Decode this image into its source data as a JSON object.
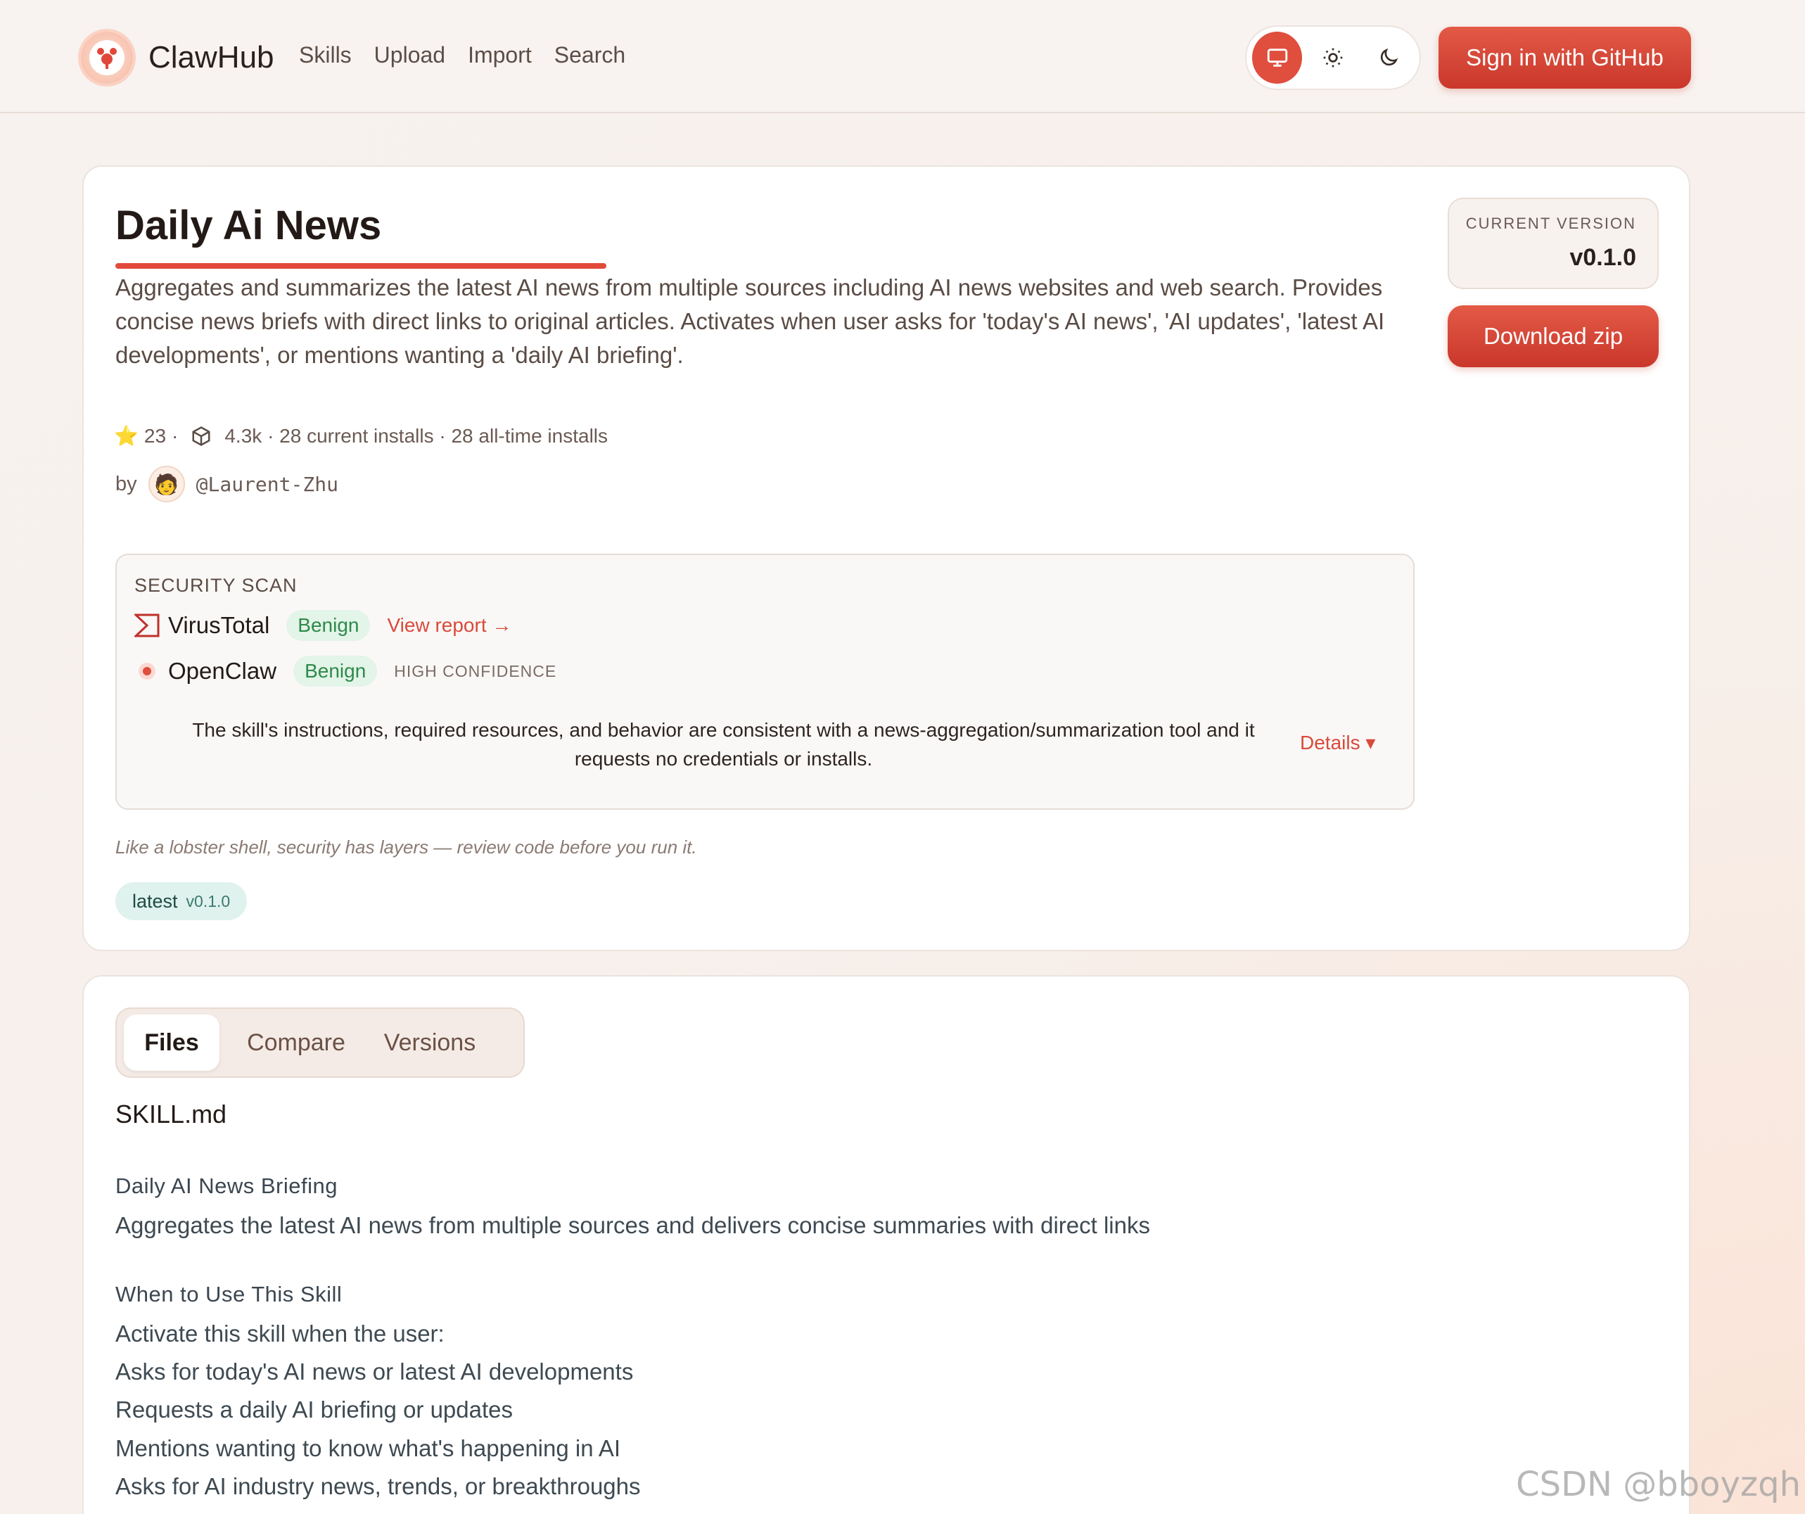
{
  "header": {
    "brand": "ClawHub",
    "nav": [
      "Skills",
      "Upload",
      "Import",
      "Search"
    ],
    "signin_label": "Sign in  with GitHub"
  },
  "skill": {
    "title": "Daily Ai News",
    "description": "Aggregates and summarizes the latest AI news from multiple sources including AI news websites and web search. Provides concise news briefs with direct links to original articles. Activates when user asks for 'today's AI news', 'AI updates', 'latest AI developments', or mentions wanting a 'daily AI briefing'.",
    "stars": "23",
    "stats_sep": "·",
    "downloads_text": "4.3k · 28 current installs · 28 all-time installs",
    "by_label": "by",
    "author": "@Laurent-Zhu",
    "current_version_label": "CURRENT VERSION",
    "current_version": "v0.1.0",
    "download_label": "Download zip"
  },
  "security": {
    "title": "SECURITY SCAN",
    "virustotal": {
      "name": "VirusTotal",
      "status": "Benign",
      "link": "View report →"
    },
    "openclaw": {
      "name": "OpenClaw",
      "status": "Benign",
      "confidence": "HIGH CONFIDENCE"
    },
    "summary": "The skill's instructions, required resources, and behavior are consistent with a news-aggregation/summarization tool and it requests no credentials or installs.",
    "details_label": "Details ▾"
  },
  "tagline": "Like a lobster shell, security has layers — review code before you run it.",
  "tag": {
    "name": "latest",
    "version": "v0.1.0"
  },
  "files": {
    "tabs": [
      "Files",
      "Compare",
      "Versions"
    ],
    "file_name": "SKILL.md",
    "lines": [
      "Daily AI News Briefing",
      "Aggregates the latest AI news from multiple sources and delivers concise summaries with direct links",
      "When to Use This Skill",
      "Activate this skill when the user:",
      "Asks for today's AI news or latest AI developments",
      "Requests a daily AI briefing or updates",
      "Mentions wanting to know what's happening in AI",
      "Asks for AI industry news, trends, or breakthroughs"
    ]
  },
  "watermark": "CSDN @bboyzqh",
  "colors": {
    "accent": "#e04e3e",
    "benign": "#2f8a4a",
    "tag_bg": "#dff2ee"
  }
}
